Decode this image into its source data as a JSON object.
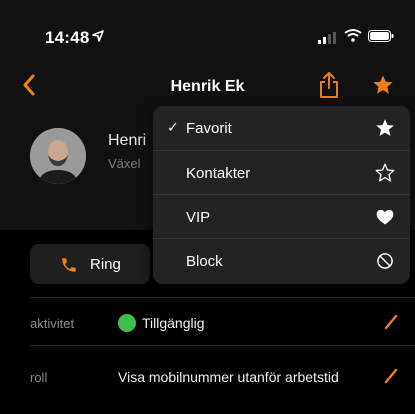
{
  "status_bar": {
    "time": "14:48"
  },
  "nav": {
    "title": "Henrik Ek"
  },
  "profile": {
    "name": "Henri",
    "subtitle": "Växel"
  },
  "actions": {
    "call_label": "Ring"
  },
  "rows": [
    {
      "label": "aktivitet",
      "value": "Tillgänglig"
    },
    {
      "label": "roll",
      "value": "Visa mobilnummer utanför arbetstid"
    }
  ],
  "menu": {
    "items": [
      {
        "label": "Favorit",
        "checked": "✓",
        "icon": "star-filled-icon"
      },
      {
        "label": "Kontakter",
        "checked": "",
        "icon": "star-outline-icon"
      },
      {
        "label": "VIP",
        "checked": "",
        "icon": "heart-icon"
      },
      {
        "label": "Block",
        "checked": "",
        "icon": "block-icon"
      }
    ]
  },
  "colors": {
    "accent": "#f07f1a",
    "status_available": "#3fbf4c",
    "background": "#000000",
    "menu_bg": "#232323"
  }
}
